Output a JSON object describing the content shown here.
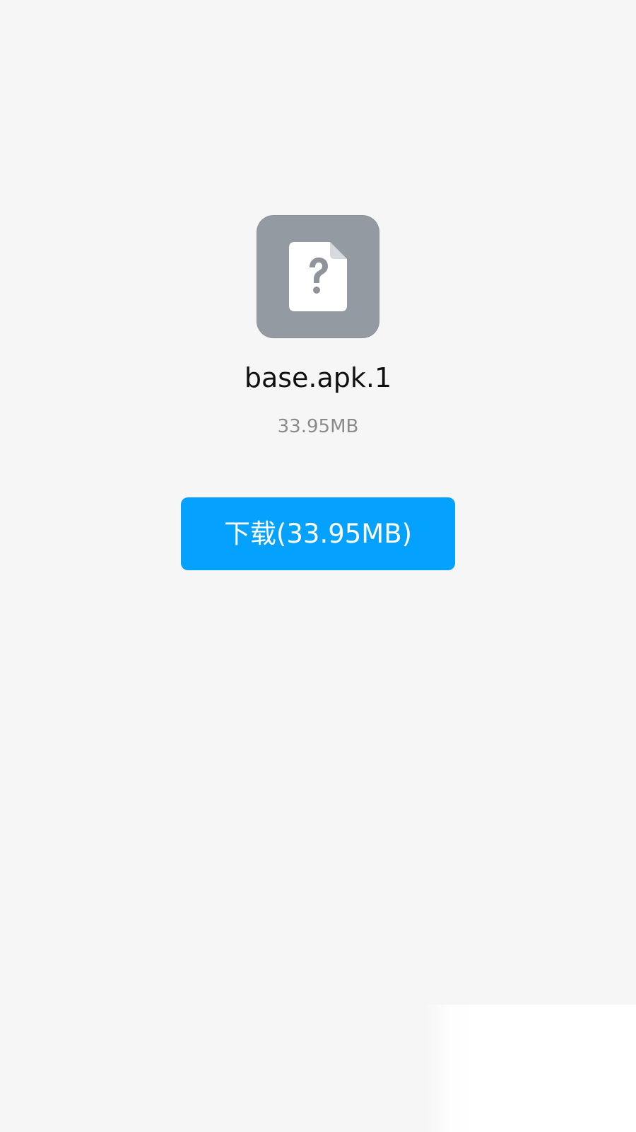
{
  "file": {
    "icon": "unknown-file-icon",
    "name": "base.apk.1",
    "size": "33.95MB"
  },
  "actions": {
    "download_label": "下载(33.95MB)"
  },
  "colors": {
    "background": "#f6f6f6",
    "icon_tile": "#949aa1",
    "button": "#05a1ff",
    "button_text": "#ffffff",
    "size_text": "#8b8b8b"
  }
}
